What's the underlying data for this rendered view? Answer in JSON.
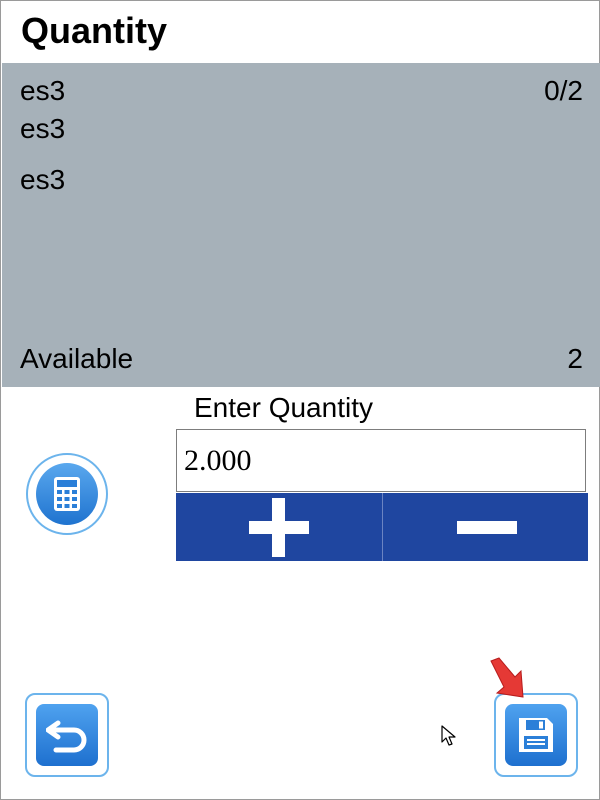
{
  "header": {
    "title": "Quantity"
  },
  "info": {
    "line1": "es3",
    "count": "0/2",
    "line2": "es3",
    "line3": "es3",
    "available_label": "Available",
    "available_value": "2"
  },
  "entry": {
    "label": "Enter Quantity",
    "value": "2.000"
  },
  "icons": {
    "calculator": "calculator-icon",
    "plus": "plus-icon",
    "minus": "minus-icon",
    "back": "undo-arrow-icon",
    "save": "floppy-disk-icon"
  },
  "colors": {
    "panel": "#a6b1b9",
    "stepper": "#1f46a0",
    "accent": "#2b84e0",
    "highlight_arrow": "#e53935"
  }
}
